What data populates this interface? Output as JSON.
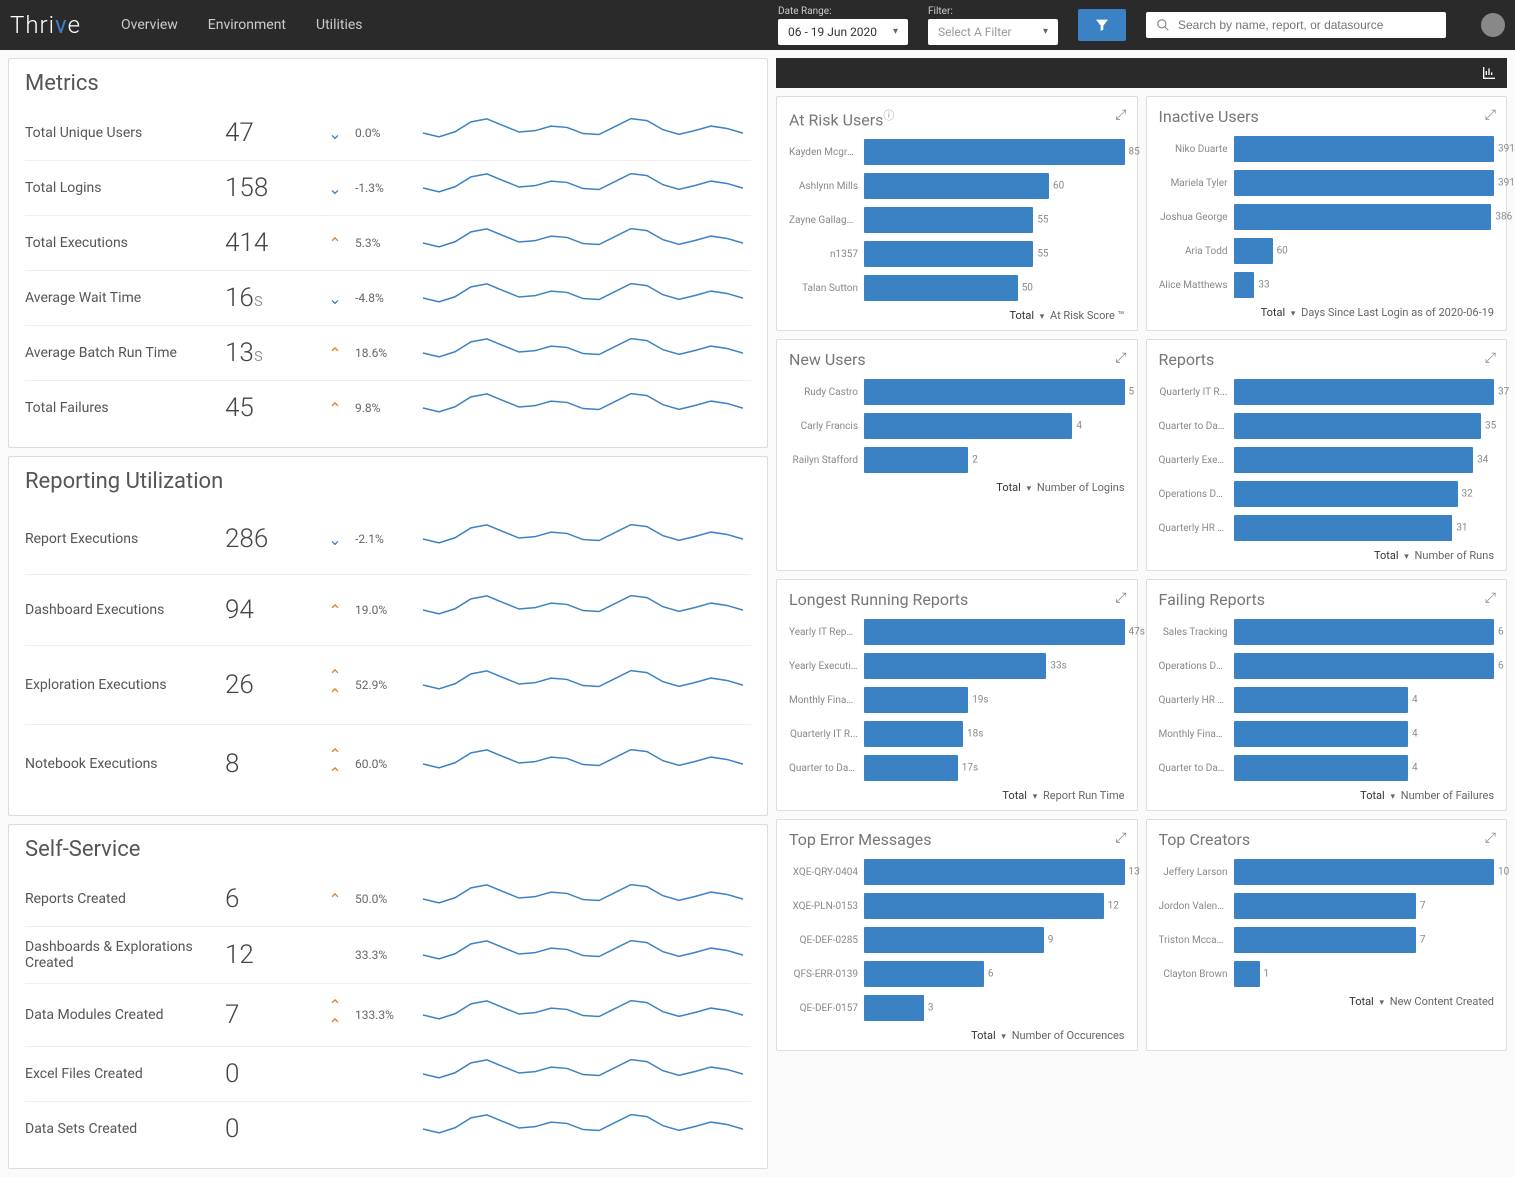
{
  "header": {
    "logo_pre": "Thri",
    "logo_v": "v",
    "logo_post": "e",
    "nav": [
      "Overview",
      "Environment",
      "Utilities"
    ],
    "date_label": "Date Range:",
    "date_value": "06 - 19 Jun 2020",
    "filter_label": "Filter:",
    "filter_placeholder": "Select A Filter",
    "search_placeholder": "Search by name, report, or datasource"
  },
  "metrics": {
    "title": "Metrics",
    "rows": [
      {
        "label": "Total Unique Users",
        "value": "47",
        "unit": "",
        "trend": "down",
        "pct": "0.0%"
      },
      {
        "label": "Total Logins",
        "value": "158",
        "unit": "",
        "trend": "down",
        "pct": "-1.3%"
      },
      {
        "label": "Total Executions",
        "value": "414",
        "unit": "",
        "trend": "up",
        "pct": "5.3%"
      },
      {
        "label": "Average Wait Time",
        "value": "16",
        "unit": "s",
        "trend": "down",
        "pct": "-4.8%"
      },
      {
        "label": "Average Batch Run Time",
        "value": "13",
        "unit": "s",
        "trend": "up",
        "pct": "18.6%"
      },
      {
        "label": "Total Failures",
        "value": "45",
        "unit": "",
        "trend": "up",
        "pct": "9.8%"
      }
    ]
  },
  "reporting": {
    "title": "Reporting Utilization",
    "rows": [
      {
        "label": "Report Executions",
        "value": "286",
        "unit": "",
        "trend": "down",
        "pct": "-2.1%"
      },
      {
        "label": "Dashboard Executions",
        "value": "94",
        "unit": "",
        "trend": "up",
        "pct": "19.0%"
      },
      {
        "label": "Exploration Executions",
        "value": "26",
        "unit": "",
        "trend": "dup",
        "pct": "52.9%"
      },
      {
        "label": "Notebook Executions",
        "value": "8",
        "unit": "",
        "trend": "dup",
        "pct": "60.0%"
      }
    ]
  },
  "selfservice": {
    "title": "Self-Service",
    "rows": [
      {
        "label": "Reports Created",
        "value": "6",
        "unit": "",
        "trend": "up",
        "pct": "50.0%"
      },
      {
        "label": "Dashboards & Explorations Created",
        "value": "12",
        "unit": "",
        "trend": "none",
        "pct": "33.3%"
      },
      {
        "label": "Data Modules Created",
        "value": "7",
        "unit": "",
        "trend": "dup",
        "pct": "133.3%"
      },
      {
        "label": "Excel Files Created",
        "value": "0",
        "unit": "",
        "trend": "none",
        "pct": ""
      },
      {
        "label": "Data Sets Created",
        "value": "0",
        "unit": "",
        "trend": "none",
        "pct": ""
      }
    ]
  },
  "charts": [
    {
      "title": "At Risk Users",
      "info": true,
      "footer_sel": "Total",
      "footer_txt": "At Risk Score ™",
      "max": 85,
      "bars": [
        {
          "label": "Kayden Mcgrath",
          "val": "85"
        },
        {
          "label": "Ashlynn Mills",
          "val": "60"
        },
        {
          "label": "Zayne Gallagher",
          "val": "55"
        },
        {
          "label": "n1357",
          "val": "55"
        },
        {
          "label": "Talan Sutton",
          "val": "50"
        }
      ]
    },
    {
      "title": "Inactive Users",
      "info": false,
      "footer_sel": "Total",
      "footer_txt": "Days Since Last Login as of 2020-06-19",
      "max": 391,
      "bars": [
        {
          "label": "Niko Duarte",
          "val": "391"
        },
        {
          "label": "Mariela Tyler",
          "val": "391"
        },
        {
          "label": "Joshua George",
          "val": "386"
        },
        {
          "label": "Aria Todd",
          "val": "60"
        },
        {
          "label": "Alice Matthews",
          "val": "33"
        }
      ]
    },
    {
      "title": "New Users",
      "info": false,
      "footer_sel": "Total",
      "footer_txt": "Number of Logins",
      "max": 5,
      "bars": [
        {
          "label": "Rudy Castro",
          "val": "5"
        },
        {
          "label": "Carly Francis",
          "val": "4"
        },
        {
          "label": "Railyn Stafford",
          "val": "2"
        }
      ]
    },
    {
      "title": "Reports",
      "info": false,
      "footer_sel": "Total",
      "footer_txt": "Number of Runs",
      "max": 37,
      "bars": [
        {
          "label": "Quarterly IT R...",
          "val": "37"
        },
        {
          "label": "Quarter to Dat...",
          "val": "35"
        },
        {
          "label": "Quarterly Exec...",
          "val": "34"
        },
        {
          "label": "Operations Das...",
          "val": "32"
        },
        {
          "label": "Quarterly HR S...",
          "val": "31"
        }
      ]
    },
    {
      "title": "Longest Running Reports",
      "info": false,
      "footer_sel": "Total",
      "footer_txt": "Report Run Time",
      "max": 47,
      "bars": [
        {
          "label": "Yearly IT Report",
          "val": "47s"
        },
        {
          "label": "Yearly Executi...",
          "val": "33s"
        },
        {
          "label": "Monthly Financ...",
          "val": "19s"
        },
        {
          "label": "Quarterly IT R...",
          "val": "18s"
        },
        {
          "label": "Quarter to Dat...",
          "val": "17s"
        }
      ]
    },
    {
      "title": "Failing Reports",
      "info": false,
      "footer_sel": "Total",
      "footer_txt": "Number of Failures",
      "max": 6,
      "bars": [
        {
          "label": "Sales Tracking",
          "val": "6"
        },
        {
          "label": "Operations Das...",
          "val": "6"
        },
        {
          "label": "Quarterly HR S...",
          "val": "4"
        },
        {
          "label": "Monthly Financ...",
          "val": "4"
        },
        {
          "label": "Quarter to Dat...",
          "val": "4"
        }
      ]
    },
    {
      "title": "Top Error Messages",
      "info": false,
      "footer_sel": "Total",
      "footer_txt": "Number of Occurences",
      "max": 13,
      "bars": [
        {
          "label": "XQE-QRY-0404",
          "val": "13"
        },
        {
          "label": "XQE-PLN-0153",
          "val": "12"
        },
        {
          "label": "QE-DEF-0285",
          "val": "9"
        },
        {
          "label": "QFS-ERR-0139",
          "val": "6"
        },
        {
          "label": "QE-DEF-0157",
          "val": "3"
        }
      ]
    },
    {
      "title": "Top Creators",
      "info": false,
      "footer_sel": "Total",
      "footer_txt": "New Content Created",
      "max": 10,
      "bars": [
        {
          "label": "Jeffery Larson",
          "val": "10"
        },
        {
          "label": "Jordon Valencia",
          "val": "7"
        },
        {
          "label": "Triston Mccann",
          "val": "7"
        },
        {
          "label": "Clayton Brown",
          "val": "1"
        }
      ]
    }
  ],
  "chart_data": [
    {
      "type": "bar",
      "title": "At Risk Users",
      "xlabel": "",
      "ylabel": "At Risk Score ™",
      "categories": [
        "Kayden Mcgrath",
        "Ashlynn Mills",
        "Zayne Gallagher",
        "n1357",
        "Talan Sutton"
      ],
      "values": [
        85,
        60,
        55,
        55,
        50
      ]
    },
    {
      "type": "bar",
      "title": "Inactive Users",
      "xlabel": "",
      "ylabel": "Days Since Last Login as of 2020-06-19",
      "categories": [
        "Niko Duarte",
        "Mariela Tyler",
        "Joshua George",
        "Aria Todd",
        "Alice Matthews"
      ],
      "values": [
        391,
        391,
        386,
        60,
        33
      ]
    },
    {
      "type": "bar",
      "title": "New Users",
      "xlabel": "",
      "ylabel": "Number of Logins",
      "categories": [
        "Rudy Castro",
        "Carly Francis",
        "Railyn Stafford"
      ],
      "values": [
        5,
        4,
        2
      ]
    },
    {
      "type": "bar",
      "title": "Reports",
      "xlabel": "",
      "ylabel": "Number of Runs",
      "categories": [
        "Quarterly IT R...",
        "Quarter to Dat...",
        "Quarterly Exec...",
        "Operations Das...",
        "Quarterly HR S..."
      ],
      "values": [
        37,
        35,
        34,
        32,
        31
      ]
    },
    {
      "type": "bar",
      "title": "Longest Running Reports",
      "xlabel": "",
      "ylabel": "Report Run Time (s)",
      "categories": [
        "Yearly IT Report",
        "Yearly Executi...",
        "Monthly Financ...",
        "Quarterly IT R...",
        "Quarter to Dat..."
      ],
      "values": [
        47,
        33,
        19,
        18,
        17
      ]
    },
    {
      "type": "bar",
      "title": "Failing Reports",
      "xlabel": "",
      "ylabel": "Number of Failures",
      "categories": [
        "Sales Tracking",
        "Operations Das...",
        "Quarterly HR S...",
        "Monthly Financ...",
        "Quarter to Dat..."
      ],
      "values": [
        6,
        6,
        4,
        4,
        4
      ]
    },
    {
      "type": "bar",
      "title": "Top Error Messages",
      "xlabel": "",
      "ylabel": "Number of Occurences",
      "categories": [
        "XQE-QRY-0404",
        "XQE-PLN-0153",
        "QE-DEF-0285",
        "QFS-ERR-0139",
        "QE-DEF-0157"
      ],
      "values": [
        13,
        12,
        9,
        6,
        3
      ]
    },
    {
      "type": "bar",
      "title": "Top Creators",
      "xlabel": "",
      "ylabel": "New Content Created",
      "categories": [
        "Jeffery Larson",
        "Jordon Valencia",
        "Triston Mccann",
        "Clayton Brown"
      ],
      "values": [
        10,
        7,
        7,
        1
      ]
    }
  ]
}
